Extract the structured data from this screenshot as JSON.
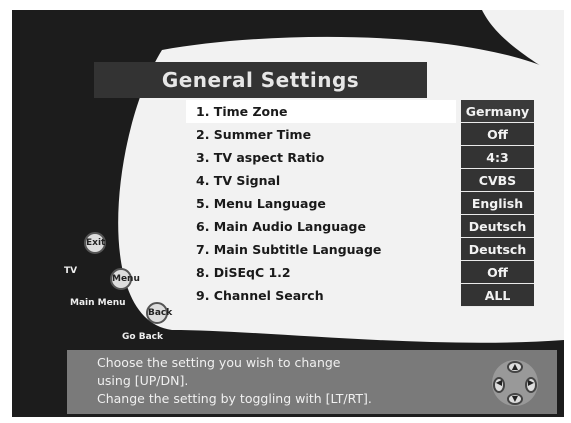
{
  "title": "General Settings",
  "menu": [
    {
      "label": "1. Time Zone",
      "value": "Germany",
      "selected": true
    },
    {
      "label": "2. Summer Time",
      "value": "Off",
      "selected": false
    },
    {
      "label": "3. TV aspect Ratio",
      "value": "4:3",
      "selected": false
    },
    {
      "label": "4. TV Signal",
      "value": "CVBS",
      "selected": false
    },
    {
      "label": "5. Menu Language",
      "value": "English",
      "selected": false
    },
    {
      "label": "6. Main Audio Language",
      "value": "Deutsch",
      "selected": false
    },
    {
      "label": "7. Main Subtitle Language",
      "value": "Deutsch",
      "selected": false
    },
    {
      "label": "8. DiSEqC 1.2",
      "value": "Off",
      "selected": false
    },
    {
      "label": "9. Channel Search",
      "value": "ALL",
      "selected": false
    }
  ],
  "help": {
    "line1": "Choose the setting you wish to change",
    "line2": "using [UP/DN].",
    "line3": "Change the setting by toggling with [LT/RT]."
  },
  "buttons": {
    "exit": {
      "icon": "Exit",
      "label": "TV"
    },
    "menu": {
      "icon": "Menu",
      "label": "Main Menu"
    },
    "back": {
      "icon": "Back",
      "label": "Go Back"
    }
  },
  "colors": {
    "background": "#1c1c1c",
    "bar": "#333333",
    "panel": "#eaeaea",
    "help": "#7a7a7a"
  },
  "icons": {
    "navigation": "dpad-icon"
  }
}
